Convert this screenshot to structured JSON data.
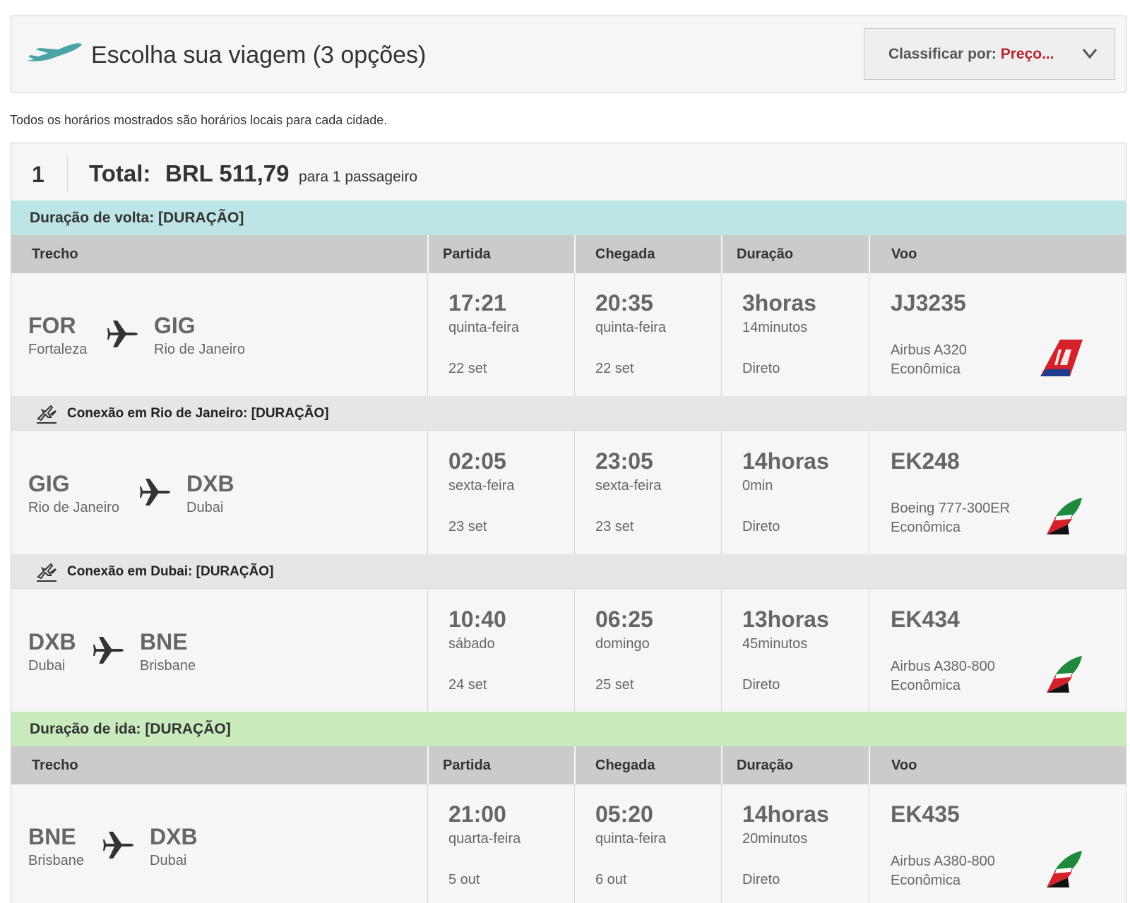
{
  "header": {
    "title": "Escolha sua viagem (3 opções)",
    "sort_label": "Classificar por:",
    "sort_value": "Preço..."
  },
  "note": "Todos os horários mostrados são horários locais para cada cidade.",
  "result": {
    "number": "1",
    "total_label": "Total:",
    "total_price": "BRL 511,79",
    "passengers": "para 1 passageiro"
  },
  "columns": {
    "trecho": "Trecho",
    "partida": "Partida",
    "chegada": "Chegada",
    "duracao": "Duração",
    "voo": "Voo"
  },
  "legs": {
    "return": {
      "banner": "Duração de volta: [DURAÇÃO]",
      "segments": [
        {
          "from_code": "FOR",
          "from_city": "Fortaleza",
          "to_code": "GIG",
          "to_city": "Rio de Janeiro",
          "dep_time": "17:21",
          "dep_day": "quinta-feira",
          "dep_date": "22 set",
          "arr_time": "20:35",
          "arr_day": "quinta-feira",
          "arr_date": "22 set",
          "dur_main": "3horas",
          "dur_sub": "14minutos",
          "stops": "Direto",
          "flight": "JJ3235",
          "aircraft": "Airbus A320",
          "cabin": "Econômica",
          "airline_logo": "tam-logo"
        },
        {
          "from_code": "GIG",
          "from_city": "Rio de Janeiro",
          "to_code": "DXB",
          "to_city": "Dubai",
          "dep_time": "02:05",
          "dep_day": "sexta-feira",
          "dep_date": "23 set",
          "arr_time": "23:05",
          "arr_day": "sexta-feira",
          "arr_date": "23 set",
          "dur_main": "14horas",
          "dur_sub": "0min",
          "stops": "Direto",
          "flight": "EK248",
          "aircraft": "Boeing 777-300ER",
          "cabin": "Econômica",
          "airline_logo": "emirates-logo"
        },
        {
          "from_code": "DXB",
          "from_city": "Dubai",
          "to_code": "BNE",
          "to_city": "Brisbane",
          "dep_time": "10:40",
          "dep_day": "sábado",
          "dep_date": "24 set",
          "arr_time": "06:25",
          "arr_day": "domingo",
          "arr_date": "25 set",
          "dur_main": "13horas",
          "dur_sub": "45minutos",
          "stops": "Direto",
          "flight": "EK434",
          "aircraft": "Airbus A380-800",
          "cabin": "Econômica",
          "airline_logo": "emirates-logo"
        }
      ],
      "connections": [
        "Conexão em Rio de Janeiro: [DURAÇÃO]",
        "Conexão em Dubai: [DURAÇÃO]"
      ]
    },
    "outbound": {
      "banner": "Duração de ida: [DURAÇÃO]",
      "segments": [
        {
          "from_code": "BNE",
          "from_city": "Brisbane",
          "to_code": "DXB",
          "to_city": "Dubai",
          "dep_time": "21:00",
          "dep_day": "quarta-feira",
          "dep_date": "5 out",
          "arr_time": "05:20",
          "arr_day": "quinta-feira",
          "arr_date": "6 out",
          "dur_main": "14horas",
          "dur_sub": "20minutos",
          "stops": "Direto",
          "flight": "EK435",
          "aircraft": "Airbus A380-800",
          "cabin": "Econômica",
          "airline_logo": "emirates-logo"
        }
      ]
    }
  },
  "colors": {
    "return_banner": "#bde5e6",
    "outbound_banner": "#c8eabd",
    "sort_accent": "#b8232e",
    "header_plane": "#4aa3a5"
  }
}
